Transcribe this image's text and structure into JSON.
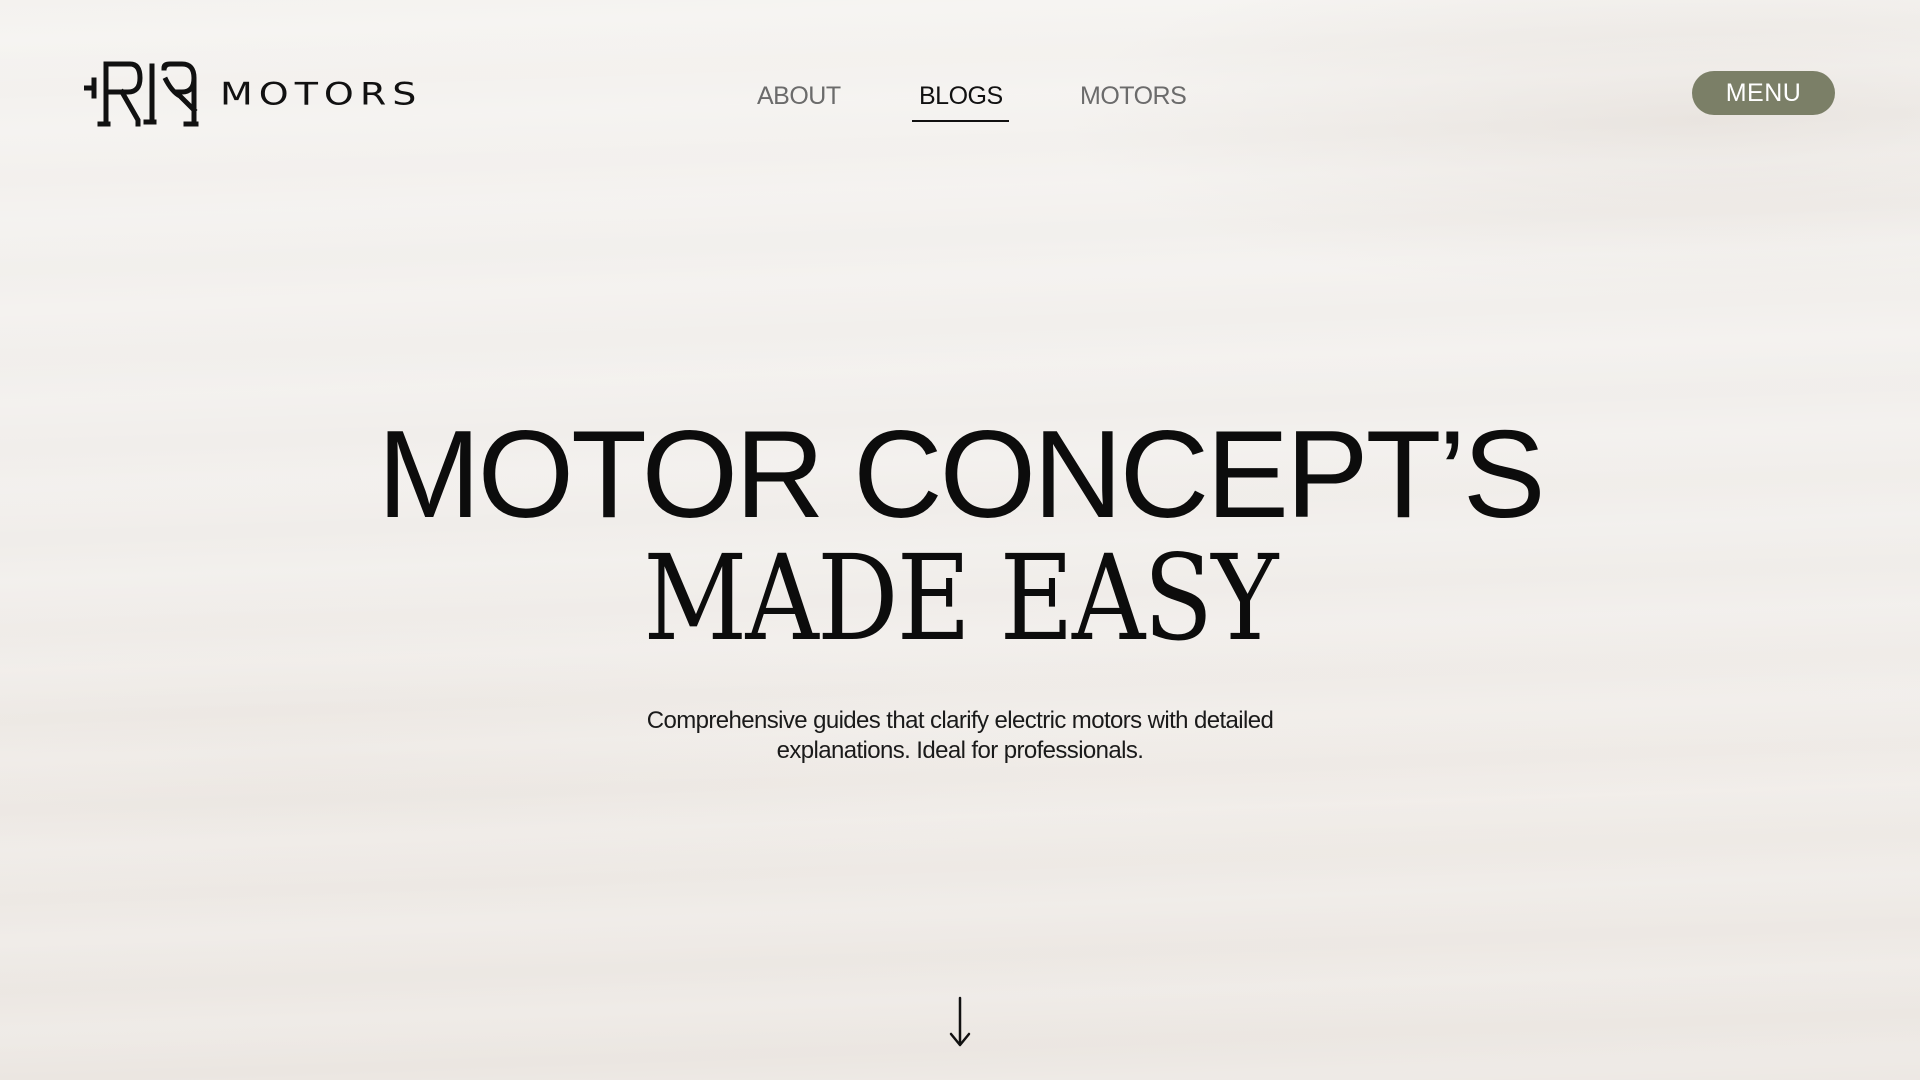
{
  "brand": {
    "logo_icon": "rr-monogram-logo",
    "name": "MOTORS"
  },
  "nav": {
    "items": [
      {
        "label": "ABOUT",
        "active": false
      },
      {
        "label": "BLOGS",
        "active": true
      },
      {
        "label": "MOTORS",
        "active": false
      }
    ]
  },
  "menu_button": {
    "label": "MENU",
    "color": "#7b7f67"
  },
  "hero": {
    "title_line_1": "MOTOR CONCEPT’S",
    "title_line_2": "MADE EASY",
    "subtitle": "Comprehensive guides that clarify electric motors with detailed explanations. Ideal for professionals."
  },
  "scroll_indicator": {
    "icon": "arrow-down-icon"
  },
  "colors": {
    "background": "#f2efec",
    "text": "#0d0d0d",
    "nav_inactive": "#6b6b6b",
    "accent": "#7b7f67"
  }
}
